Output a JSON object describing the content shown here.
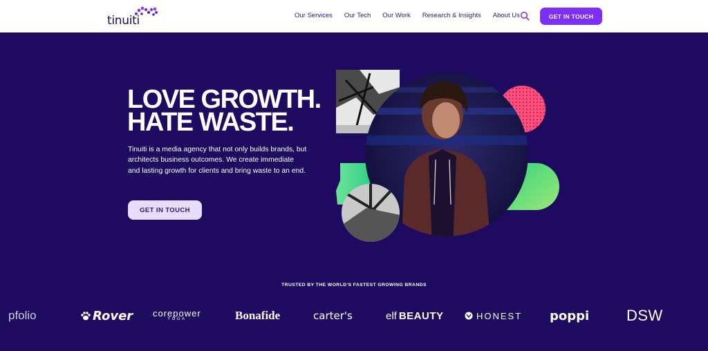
{
  "header": {
    "logo_text": "tinuiti",
    "nav": [
      "Our Services",
      "Our Tech",
      "Our Work",
      "Research & Insights",
      "About Us"
    ],
    "cta": "GET IN TOUCH"
  },
  "hero": {
    "headline_line1": "LOVE GROWTH.",
    "headline_line2": "HATE WASTE.",
    "description": "Tinuiti is a media agency that not only builds brands, but architects business outcomes. We create immediate and lasting growth for clients and bring waste to an end.",
    "cta": "GET IN TOUCH"
  },
  "trusted": {
    "heading": "TRUSTED BY THE WORLD'S FASTEST GROWING BRANDS",
    "brands": {
      "appfolio": "pfolio",
      "rover": "Rover",
      "corepower_1": "corepower",
      "corepower_2": "YOGA",
      "bonafide": "Bonafide",
      "carters": "carter's",
      "elf_a": "elf",
      "elf_b": "BEAUTY",
      "honest": "HONEST",
      "poppi": "poppi",
      "dsw": "DSW"
    }
  },
  "colors": {
    "background": "#1e0a5e",
    "accent": "#7b2ff7",
    "hero_button": "#e6ddff",
    "green": "#34d27a",
    "pink": "#ff4f7e"
  }
}
